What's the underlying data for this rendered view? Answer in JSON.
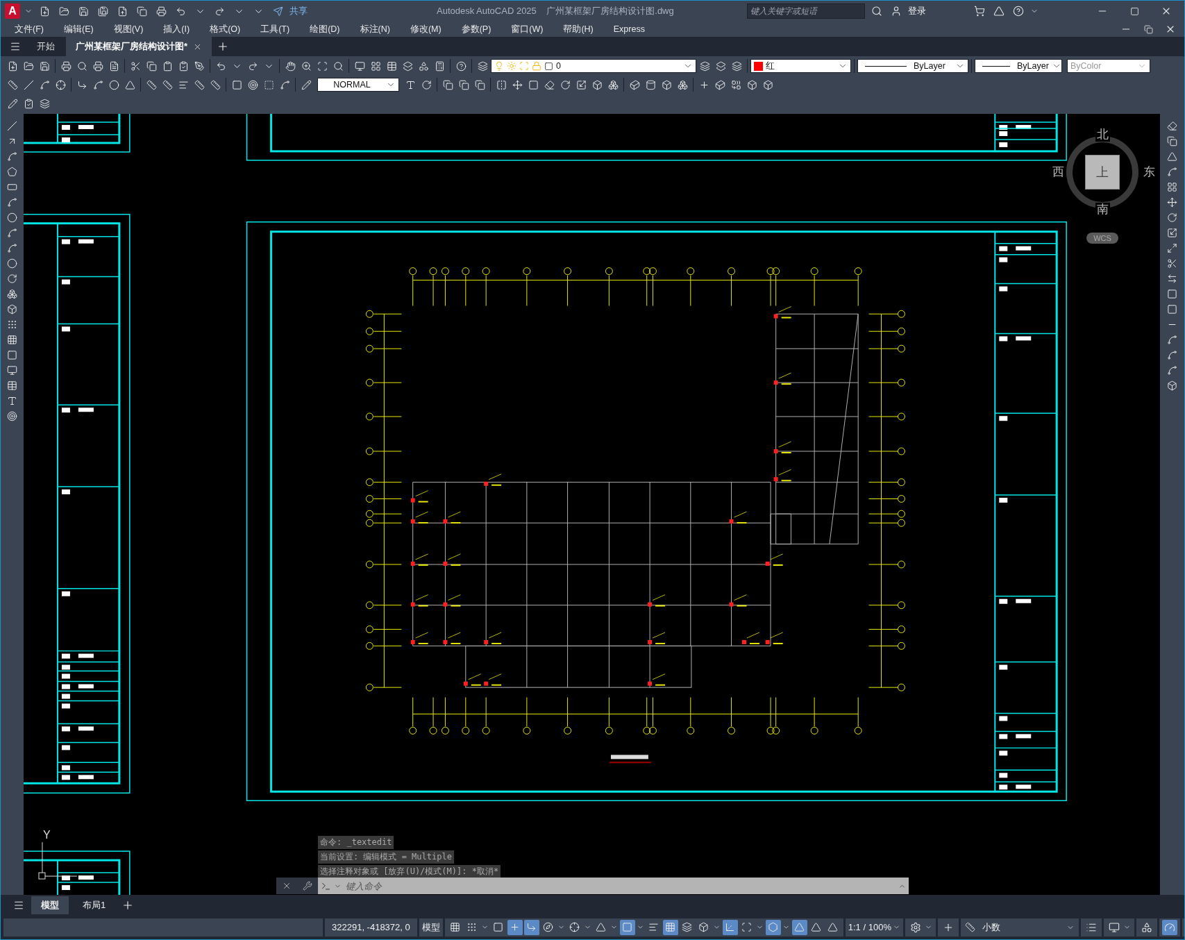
{
  "title_bar": {
    "logo": "A",
    "share": "共享",
    "app": "Autodesk AutoCAD 2025",
    "file": "广州某框架厂房结构设计图.dwg",
    "search": {
      "placeholder": "键入关键字或短语"
    },
    "login": "登录"
  },
  "menu": [
    "文件(F)",
    "编辑(E)",
    "视图(V)",
    "插入(I)",
    "格式(O)",
    "工具(T)",
    "绘图(D)",
    "标注(N)",
    "修改(M)",
    "参数(P)",
    "窗口(W)",
    "帮助(H)",
    "Express"
  ],
  "doc_tabs": [
    {
      "label": "开始",
      "selected": false
    },
    {
      "label": "广州某框架厂房结构设计图*",
      "selected": true
    }
  ],
  "properties": {
    "layer": "0",
    "color": {
      "label": "红",
      "color": "#ff0000"
    },
    "linetype": "ByLayer",
    "lineweight": "ByLayer",
    "plot_style": {
      "label": "ByColor",
      "disabled": true
    }
  },
  "text_style": "NORMAL",
  "viewcube": {
    "north": "北",
    "west": "西",
    "east": "东",
    "south": "南",
    "top": "上",
    "ucs": "WCS"
  },
  "ucs_icon": {
    "y_label": "Y"
  },
  "command_history": [
    "命令: _textedit",
    "当前设置: 编辑模式 = Multiple",
    "选择注释对象或 [放弃(U)/模式(M)]: *取消*"
  ],
  "command_line": {
    "placeholder": "键入命令"
  },
  "layout_tabs": [
    {
      "label": "模型",
      "selected": true
    },
    {
      "label": "布局1",
      "selected": false
    }
  ],
  "status_bar": {
    "coordinates": "322291, -418372, 0",
    "space": "模型",
    "toggles": [
      {
        "on": false
      },
      {
        "on": false
      },
      {
        "on": false
      },
      {
        "on": true
      },
      {
        "on": true
      },
      {
        "on": false
      },
      {
        "on": false
      },
      {
        "on": false
      },
      {
        "on": true
      },
      {
        "on": false
      },
      {
        "on": true
      },
      {
        "on": false
      },
      {
        "on": false
      },
      {
        "on": true
      },
      {
        "on": false
      },
      {
        "on": true
      },
      {
        "on": true
      },
      {
        "on": false
      },
      {
        "on": false
      }
    ],
    "annotation_scale": "1:1 / 100%",
    "units": "小数",
    "hardware_acceleration": {
      "on": true
    }
  }
}
